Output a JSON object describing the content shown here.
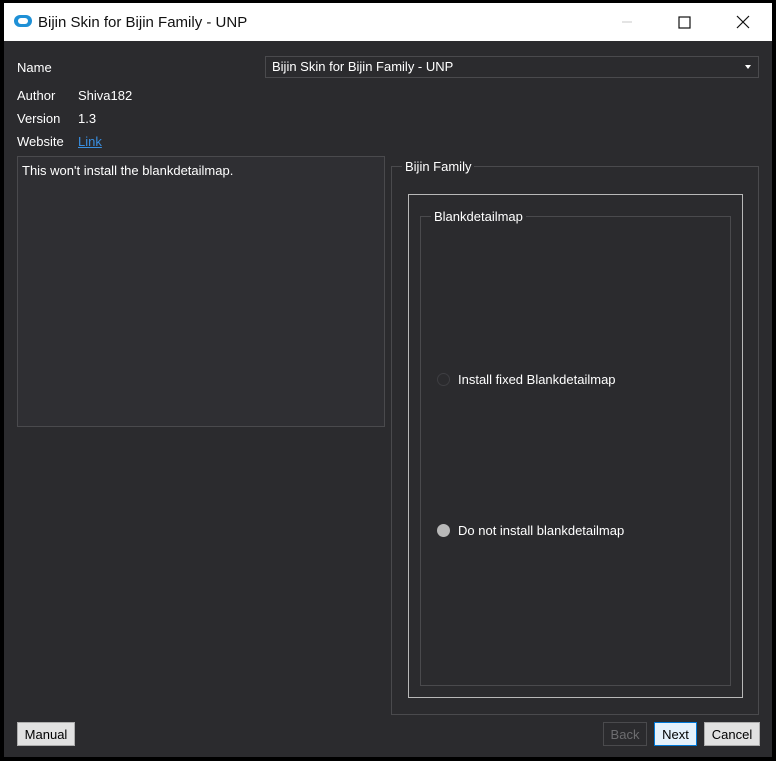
{
  "window": {
    "title": "Bijin Skin for Bijin Family - UNP",
    "accent_icon_color": "#1e90d6"
  },
  "info": {
    "name_label": "Name",
    "name_value": "Bijin Skin for Bijin Family - UNP",
    "author_label": "Author",
    "author_value": "Shiva182",
    "version_label": "Version",
    "version_value": "1.3",
    "website_label": "Website",
    "website_link": "Link"
  },
  "description": "This won't install the blankdetailmap.",
  "options": {
    "group_title": "Bijin Family",
    "subgroup_title": "Blankdetailmap",
    "choices": [
      {
        "label": "Install fixed Blankdetailmap",
        "selected": false
      },
      {
        "label": "Do not install blankdetailmap",
        "selected": true
      }
    ]
  },
  "buttons": {
    "manual": "Manual",
    "back": "Back",
    "next": "Next",
    "cancel": "Cancel"
  }
}
